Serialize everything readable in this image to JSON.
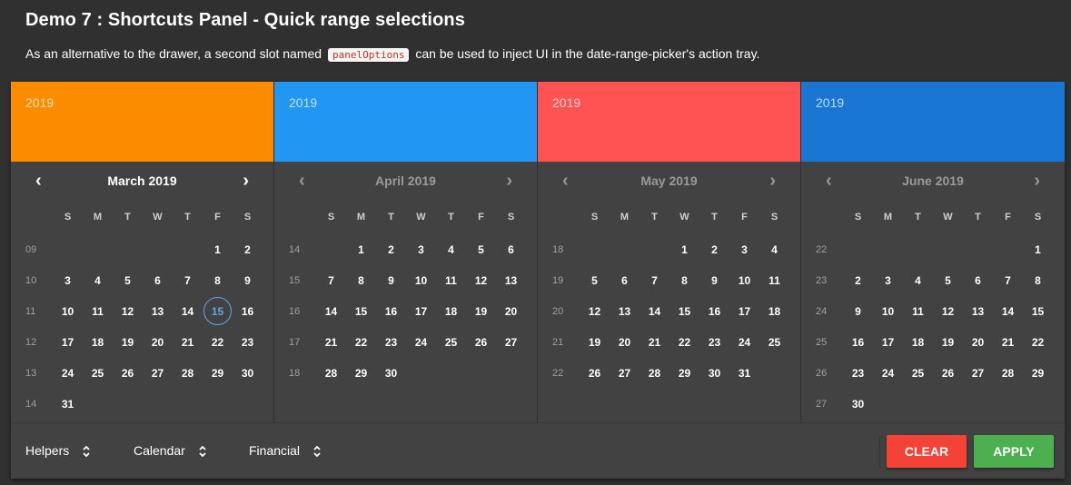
{
  "page": {
    "title": "Demo 7 : Shortcuts Panel - Quick range selections",
    "description_before": "As an alternative to the drawer, a second slot named",
    "description_code": "panelOptions",
    "description_after": "can be used to inject UI in the date-range-picker's action tray."
  },
  "weekdays": [
    "S",
    "M",
    "T",
    "W",
    "T",
    "F",
    "S"
  ],
  "months": [
    {
      "year": "2019",
      "title": "March 2019",
      "header_color": "#fb8c00",
      "active": true,
      "weeks": [
        {
          "wn": "09",
          "days": [
            "",
            "",
            "",
            "",
            "",
            "1",
            "2"
          ]
        },
        {
          "wn": "10",
          "days": [
            "3",
            "4",
            "5",
            "6",
            "7",
            "8",
            "9"
          ]
        },
        {
          "wn": "11",
          "days": [
            "10",
            "11",
            "12",
            "13",
            "14",
            "15",
            "16"
          ]
        },
        {
          "wn": "12",
          "days": [
            "17",
            "18",
            "19",
            "20",
            "21",
            "22",
            "23"
          ]
        },
        {
          "wn": "13",
          "days": [
            "24",
            "25",
            "26",
            "27",
            "28",
            "29",
            "30"
          ]
        },
        {
          "wn": "14",
          "days": [
            "31",
            "",
            "",
            "",
            "",
            "",
            ""
          ]
        }
      ],
      "today": "15"
    },
    {
      "year": "2019",
      "title": "April 2019",
      "header_color": "#2196f3",
      "active": false,
      "weeks": [
        {
          "wn": "14",
          "days": [
            "",
            "1",
            "2",
            "3",
            "4",
            "5",
            "6"
          ]
        },
        {
          "wn": "15",
          "days": [
            "7",
            "8",
            "9",
            "10",
            "11",
            "12",
            "13"
          ]
        },
        {
          "wn": "16",
          "days": [
            "14",
            "15",
            "16",
            "17",
            "18",
            "19",
            "20"
          ]
        },
        {
          "wn": "17",
          "days": [
            "21",
            "22",
            "23",
            "24",
            "25",
            "26",
            "27"
          ]
        },
        {
          "wn": "18",
          "days": [
            "28",
            "29",
            "30",
            "",
            "",
            "",
            ""
          ]
        }
      ],
      "today": ""
    },
    {
      "year": "2019",
      "title": "May 2019",
      "header_color": "#ff5252",
      "active": false,
      "weeks": [
        {
          "wn": "18",
          "days": [
            "",
            "",
            "",
            "1",
            "2",
            "3",
            "4"
          ]
        },
        {
          "wn": "19",
          "days": [
            "5",
            "6",
            "7",
            "8",
            "9",
            "10",
            "11"
          ]
        },
        {
          "wn": "20",
          "days": [
            "12",
            "13",
            "14",
            "15",
            "16",
            "17",
            "18"
          ]
        },
        {
          "wn": "21",
          "days": [
            "19",
            "20",
            "21",
            "22",
            "23",
            "24",
            "25"
          ]
        },
        {
          "wn": "22",
          "days": [
            "26",
            "27",
            "28",
            "29",
            "30",
            "31",
            ""
          ]
        }
      ],
      "today": ""
    },
    {
      "year": "2019",
      "title": "June 2019",
      "header_color": "#1976d2",
      "active": false,
      "weeks": [
        {
          "wn": "22",
          "days": [
            "",
            "",
            "",
            "",
            "",
            "",
            "1"
          ]
        },
        {
          "wn": "23",
          "days": [
            "2",
            "3",
            "4",
            "5",
            "6",
            "7",
            "8"
          ]
        },
        {
          "wn": "24",
          "days": [
            "9",
            "10",
            "11",
            "12",
            "13",
            "14",
            "15"
          ]
        },
        {
          "wn": "25",
          "days": [
            "16",
            "17",
            "18",
            "19",
            "20",
            "21",
            "22"
          ]
        },
        {
          "wn": "26",
          "days": [
            "23",
            "24",
            "25",
            "26",
            "27",
            "28",
            "29"
          ]
        },
        {
          "wn": "27",
          "days": [
            "30",
            "",
            "",
            "",
            "",
            "",
            ""
          ]
        }
      ],
      "today": ""
    }
  ],
  "footer": {
    "options": [
      "Helpers",
      "Calendar",
      "Financial"
    ],
    "clear_label": "CLEAR",
    "apply_label": "APPLY"
  },
  "icons": {
    "prev": "chevron-left-icon",
    "next": "chevron-right-icon",
    "select": "unfold-icon"
  }
}
